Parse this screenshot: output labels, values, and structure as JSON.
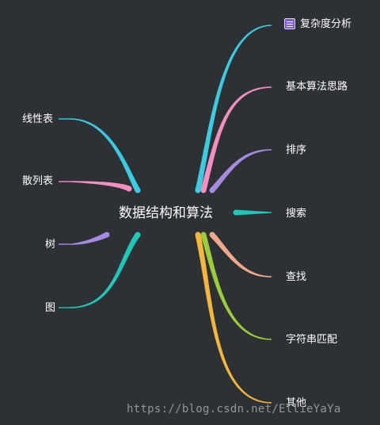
{
  "center": {
    "label": "数据结构和算法"
  },
  "left_branches": [
    {
      "label": "线性表",
      "color": "#3ccbe0"
    },
    {
      "label": "散列表",
      "color": "#f48fc0"
    },
    {
      "label": "树",
      "color": "#a78be0"
    },
    {
      "label": "图",
      "color": "#1fc8b8"
    }
  ],
  "right_branches": [
    {
      "label": "复杂度分析",
      "color": "#3ccbe0",
      "icon": "note-icon"
    },
    {
      "label": "基本算法思路",
      "color": "#f48fc0"
    },
    {
      "label": "排序",
      "color": "#a78be0"
    },
    {
      "label": "搜索",
      "color": "#1fc8b8"
    },
    {
      "label": "查找",
      "color": "#f0a98a"
    },
    {
      "label": "字符串匹配",
      "color": "#9ccc3c"
    },
    {
      "label": "其他",
      "color": "#f4b63c"
    }
  ],
  "watermark": "https://blog.csdn.net/EllieYaYa"
}
